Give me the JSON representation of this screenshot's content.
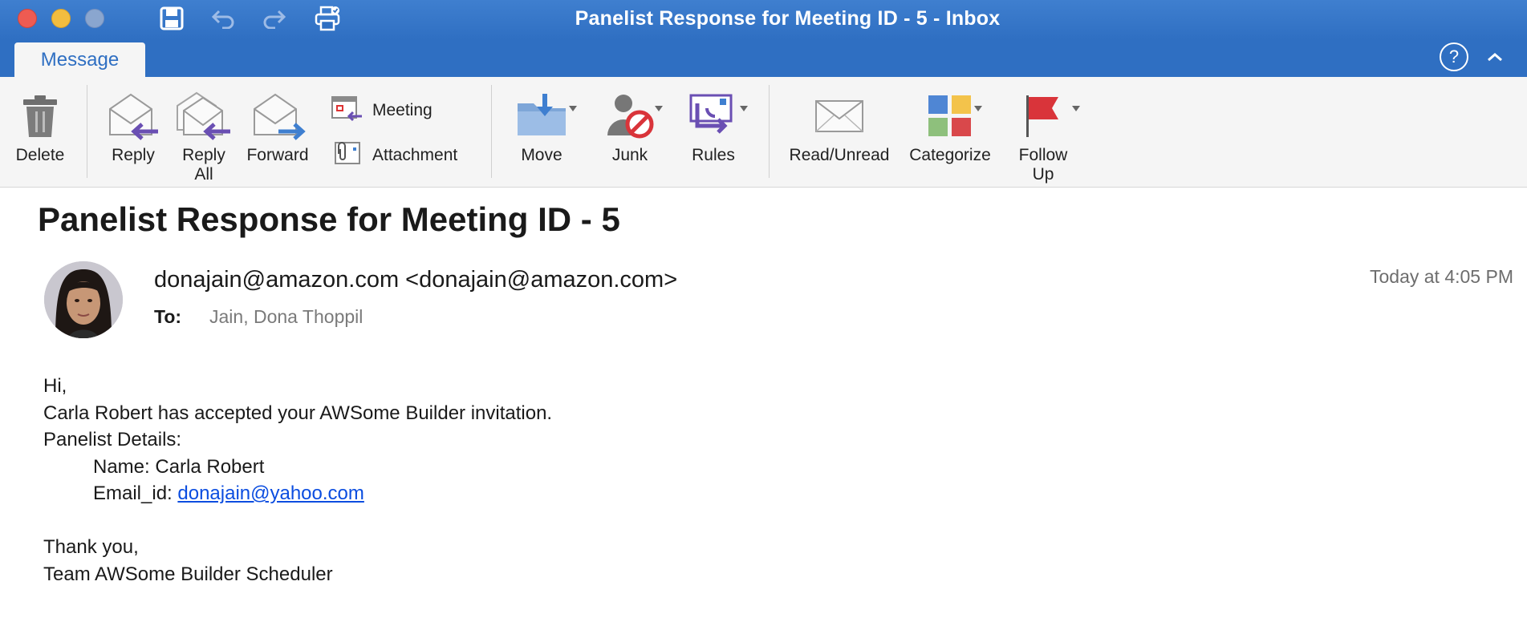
{
  "window": {
    "title": "Panelist Response for Meeting ID - 5 - Inbox"
  },
  "tabs": {
    "message": "Message",
    "help": "?"
  },
  "ribbon": {
    "delete": "Delete",
    "reply": "Reply",
    "reply_all_1": "Reply",
    "reply_all_2": "All",
    "forward": "Forward",
    "meeting": "Meeting",
    "attachment": "Attachment",
    "move": "Move",
    "junk": "Junk",
    "rules": "Rules",
    "read_unread": "Read/Unread",
    "categorize": "Categorize",
    "follow_up_1": "Follow",
    "follow_up_2": "Up"
  },
  "message": {
    "subject": "Panelist Response for Meeting ID - 5",
    "from": "donajain@amazon.com <donajain@amazon.com>",
    "to_label": "To:",
    "to_value": "Jain, Dona Thoppil",
    "time": "Today at 4:05 PM",
    "body": {
      "greeting": "Hi,",
      "line1": "Carla Robert has accepted your AWSome Builder invitation.",
      "details_heading": "Panelist Details:",
      "name_line": "Name: Carla Robert",
      "email_label": "Email_id: ",
      "email_link": "donajain@yahoo.com",
      "thanks": "Thank you,",
      "signature": "Team AWSome Builder Scheduler"
    }
  },
  "colors": {
    "titlebar": "#2f6fc2",
    "ribbon": "#f5f5f5",
    "link": "#0b4de0"
  }
}
